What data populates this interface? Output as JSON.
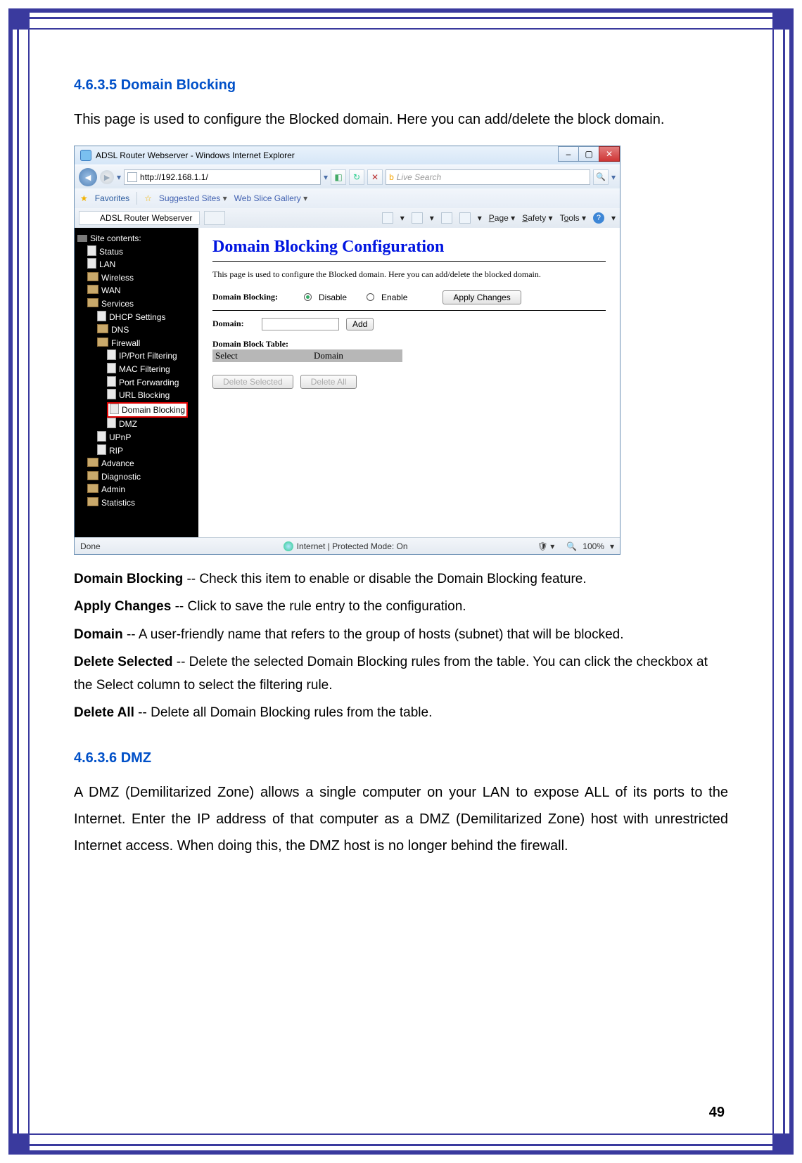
{
  "page_number": "49",
  "section1": {
    "id": "4.6.3.5",
    "title": "Domain Blocking",
    "intro": "This page is used to configure the Blocked domain. Here you can add/delete the block domain."
  },
  "section2": {
    "id": "4.6.3.6",
    "title": "DMZ",
    "body": "A DMZ (Demilitarized Zone) allows a single computer on your LAN to expose ALL of its ports to the Internet. Enter the IP address of that computer as a DMZ  (Demilitarized  Zone)  host with unrestricted Internet access. When doing this, the DMZ host is no longer behind the firewall."
  },
  "definitions": [
    {
      "term": "Domain Blocking",
      "desc": " -- Check this item to enable or disable the Domain Blocking feature."
    },
    {
      "term": "Apply Changes",
      "desc": " -- Click to save the rule entry to the configuration."
    },
    {
      "term": "Domain",
      "desc": " -- A user-friendly name that refers to the group of hosts (subnet) that will be blocked."
    },
    {
      "term": "Delete Selected",
      "desc": " -- Delete the selected Domain Blocking rules from the table. You can click the checkbox at the Select column to select the filtering rule."
    },
    {
      "term": "Delete All",
      "desc": " -- Delete all Domain Blocking rules from the table."
    }
  ],
  "ie": {
    "window_title": "ADSL Router Webserver - Windows Internet Explorer",
    "url": "http://192.168.1.1/",
    "search_placeholder": "Live Search",
    "favorites": "Favorites",
    "suggested": "Suggested Sites",
    "slice": "Web Slice Gallery",
    "tab_title": "ADSL Router Webserver",
    "toolbar": {
      "page": "Page",
      "safety": "Safety",
      "tools": "Tools"
    },
    "tree": {
      "header": "Site contents:",
      "items": [
        "Status",
        "LAN",
        "Wireless",
        "WAN",
        "Services",
        "DHCP Settings",
        "DNS",
        "Firewall",
        "IP/Port Filtering",
        "MAC Filtering",
        "Port Forwarding",
        "URL Blocking",
        "Domain Blocking",
        "DMZ",
        "UPnP",
        "RIP",
        "Advance",
        "Diagnostic",
        "Admin",
        "Statistics"
      ]
    },
    "main": {
      "heading": "Domain Blocking Configuration",
      "sub": "This page is used to configure the Blocked domain. Here you can add/delete the blocked domain.",
      "label_blocking": "Domain Blocking:",
      "opt_disable": "Disable",
      "opt_enable": "Enable",
      "btn_apply": "Apply Changes",
      "label_domain": "Domain:",
      "btn_add": "Add",
      "table_title": "Domain Block Table:",
      "col_select": "Select",
      "col_domain": "Domain",
      "btn_del_sel": "Delete Selected",
      "btn_del_all": "Delete All"
    },
    "status": {
      "left": "Done",
      "center": "Internet | Protected Mode: On",
      "zoom": "100%"
    }
  }
}
